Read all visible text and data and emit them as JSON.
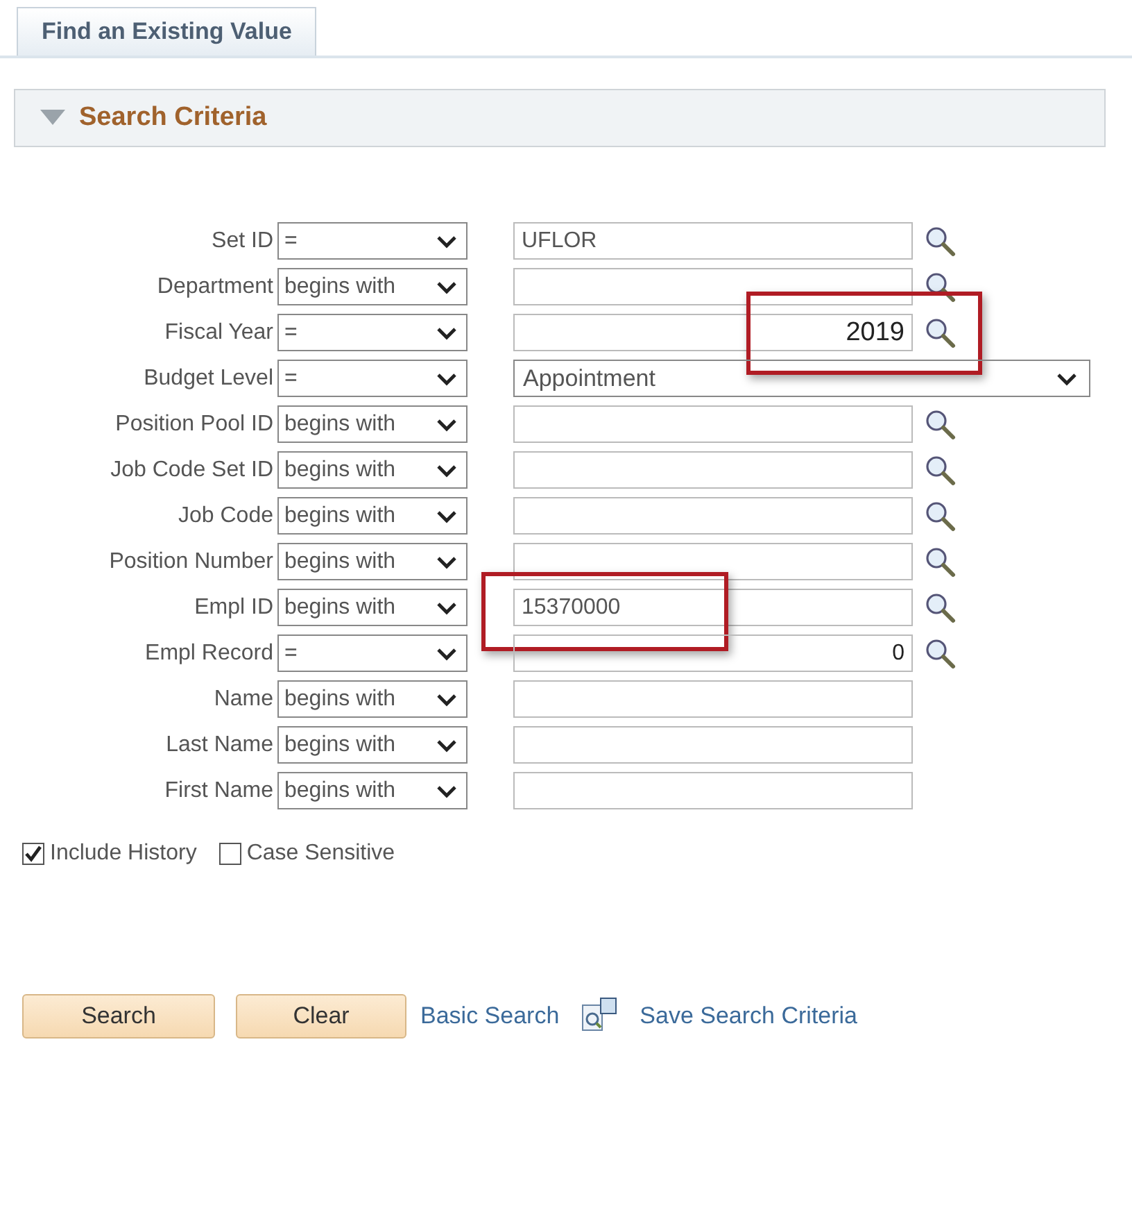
{
  "tab": {
    "label": "Find an Existing Value",
    "selected": true
  },
  "section": {
    "title": "Search Criteria",
    "expanded": true
  },
  "rows": [
    {
      "label": "Set ID",
      "operator": "=",
      "kind": "text",
      "value": "UFLOR",
      "numeric": false,
      "lookup": true,
      "highlighted": false
    },
    {
      "label": "Department",
      "operator": "begins with",
      "kind": "text",
      "value": "",
      "lookup": true,
      "highlighted": false
    },
    {
      "label": "Fiscal Year",
      "operator": "=",
      "kind": "text",
      "value": "2019",
      "numeric": true,
      "lookup": true,
      "highlighted": true
    },
    {
      "label": "Budget Level",
      "operator": "=",
      "kind": "select",
      "value": "Appointment",
      "lookup": false,
      "highlighted": false
    },
    {
      "label": "Position Pool ID",
      "operator": "begins with",
      "kind": "text",
      "value": "",
      "lookup": true,
      "highlighted": false
    },
    {
      "label": "Job Code Set ID",
      "operator": "begins with",
      "kind": "text",
      "value": "",
      "lookup": true,
      "highlighted": false
    },
    {
      "label": "Job Code",
      "operator": "begins with",
      "kind": "text",
      "value": "",
      "lookup": true,
      "highlighted": false
    },
    {
      "label": "Position Number",
      "operator": "begins with",
      "kind": "text",
      "value": "",
      "lookup": true,
      "highlighted": false
    },
    {
      "label": "Empl ID",
      "operator": "begins with",
      "kind": "text",
      "value": "15370000",
      "numeric": false,
      "lookup": true,
      "highlighted": true
    },
    {
      "label": "Empl Record",
      "operator": "=",
      "kind": "text",
      "value": "0",
      "numeric": true,
      "lookup": true,
      "highlighted": false
    },
    {
      "label": "Name",
      "operator": "begins with",
      "kind": "text",
      "value": "",
      "lookup": false,
      "highlighted": false
    },
    {
      "label": "Last Name",
      "operator": "begins with",
      "kind": "text",
      "value": "",
      "lookup": false,
      "highlighted": false
    },
    {
      "label": "First Name",
      "operator": "begins with",
      "kind": "text",
      "value": "",
      "lookup": false,
      "highlighted": false
    }
  ],
  "options": [
    {
      "label": "Include History",
      "checked": true
    },
    {
      "label": "Case Sensitive",
      "checked": false
    }
  ],
  "buttons": [
    "Search",
    "Clear"
  ],
  "links": [
    {
      "label": "Basic Search",
      "icon": false
    },
    {
      "label": "Save Search Criteria",
      "icon": true
    }
  ]
}
